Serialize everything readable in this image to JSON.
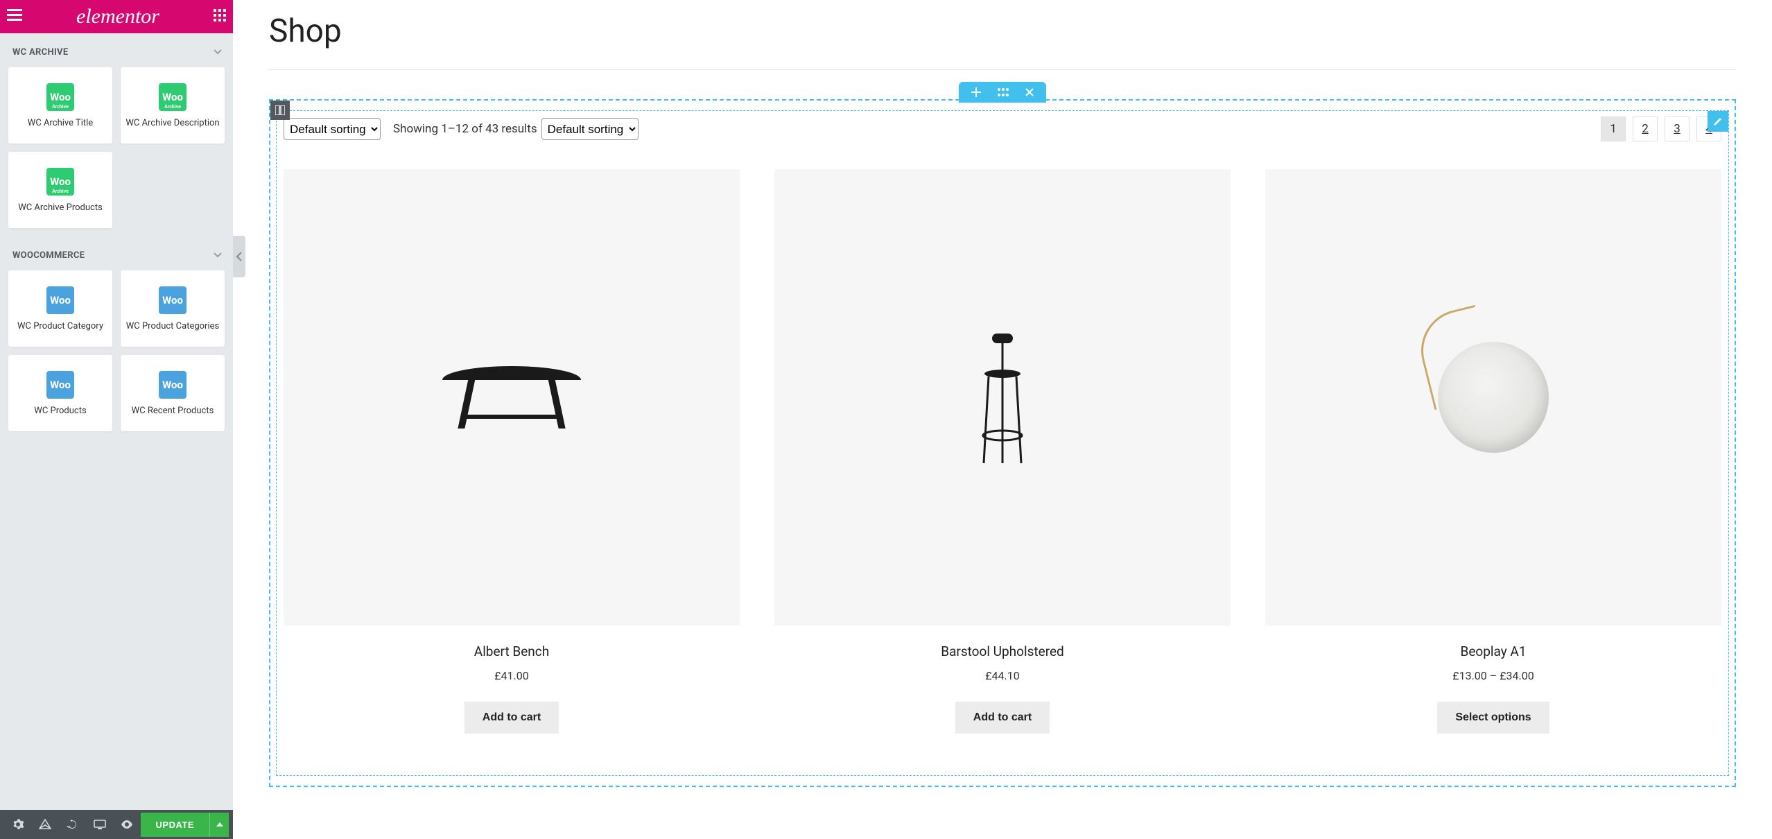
{
  "brand": "elementor",
  "sidebar": {
    "sections": [
      {
        "title": "WC ARCHIVE",
        "widgets": [
          {
            "label": "WC Archive Title",
            "icon_text": "Woo",
            "icon_sub": "Archive",
            "icon_color": "green"
          },
          {
            "label": "WC Archive Description",
            "icon_text": "Woo",
            "icon_sub": "Archive",
            "icon_color": "green"
          },
          {
            "label": "WC Archive Products",
            "icon_text": "Woo",
            "icon_sub": "Archive",
            "icon_color": "green"
          }
        ]
      },
      {
        "title": "WOOCOMMERCE",
        "widgets": [
          {
            "label": "WC Product Category",
            "icon_text": "Woo",
            "icon_sub": "",
            "icon_color": "blue"
          },
          {
            "label": "WC Product Categories",
            "icon_text": "Woo",
            "icon_sub": "",
            "icon_color": "blue"
          },
          {
            "label": "WC Products",
            "icon_text": "Woo",
            "icon_sub": "",
            "icon_color": "blue"
          },
          {
            "label": "WC Recent Products",
            "icon_text": "Woo",
            "icon_sub": "",
            "icon_color": "blue"
          }
        ]
      }
    ],
    "update_label": "UPDATE"
  },
  "page": {
    "title": "Shop",
    "sort_options": [
      "Default sorting"
    ],
    "sort_selected": "Default sorting",
    "results_text": "Showing 1–12 of 43 results",
    "pagination": [
      "1",
      "2",
      "3",
      "4"
    ],
    "pagination_active": "1",
    "products": [
      {
        "title": "Albert Bench",
        "price": "£41.00",
        "cta": "Add to cart",
        "img": "bench"
      },
      {
        "title": "Barstool Upholstered",
        "price": "£44.10",
        "cta": "Add to cart",
        "img": "stool"
      },
      {
        "title": "Beoplay A1",
        "price": "£13.00 – £34.00",
        "cta": "Select options",
        "img": "speaker"
      }
    ]
  }
}
